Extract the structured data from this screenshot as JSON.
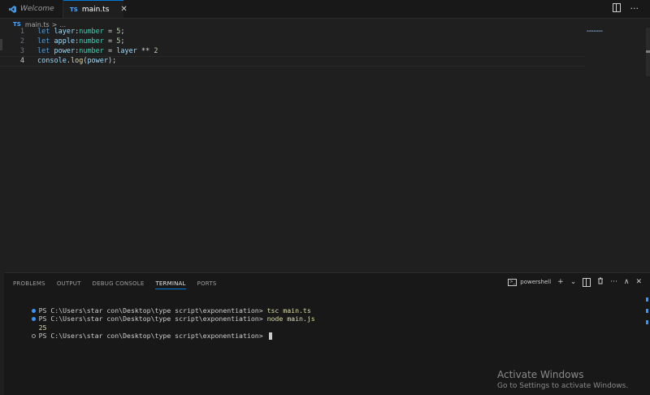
{
  "tabs": [
    {
      "label": "Welcome",
      "active": false
    },
    {
      "label": "main.ts",
      "active": true
    }
  ],
  "tab_badge": "TS",
  "breadcrumb": {
    "file": "main.ts",
    "separator": ">",
    "rest": "..."
  },
  "editor": {
    "lines": [
      {
        "number": "1",
        "tokens": [
          [
            "kw",
            "let"
          ],
          [
            "pl",
            " "
          ],
          [
            "var",
            "layer"
          ],
          [
            "pl",
            ":"
          ],
          [
            "ty",
            "number"
          ],
          [
            "pl",
            " = "
          ],
          [
            "num",
            "5"
          ],
          [
            "pl",
            ";"
          ]
        ]
      },
      {
        "number": "2",
        "tokens": [
          [
            "kw",
            "let"
          ],
          [
            "pl",
            " "
          ],
          [
            "var",
            "apple"
          ],
          [
            "pl",
            ":"
          ],
          [
            "ty",
            "number"
          ],
          [
            "pl",
            " = "
          ],
          [
            "num",
            "5"
          ],
          [
            "pl",
            ";"
          ]
        ]
      },
      {
        "number": "3",
        "tokens": [
          [
            "kw",
            "let"
          ],
          [
            "pl",
            " "
          ],
          [
            "var",
            "power"
          ],
          [
            "pl",
            ":"
          ],
          [
            "ty",
            "number"
          ],
          [
            "pl",
            " = "
          ],
          [
            "var",
            "layer"
          ],
          [
            "pl",
            " ** "
          ],
          [
            "num",
            "2"
          ]
        ]
      },
      {
        "number": "4",
        "tokens": [
          [
            "var",
            "console"
          ],
          [
            "pl",
            "."
          ],
          [
            "fn",
            "log"
          ],
          [
            "pl",
            "("
          ],
          [
            "var",
            "power"
          ],
          [
            "pl",
            ");"
          ]
        ]
      }
    ],
    "active_line": 4
  },
  "panel": {
    "tabs": [
      "PROBLEMS",
      "OUTPUT",
      "DEBUG CONSOLE",
      "TERMINAL",
      "PORTS"
    ],
    "active_tab": "TERMINAL",
    "shell": "powershell",
    "actions": {
      "add": "+",
      "dropdown": "⌄",
      "more": "···",
      "maximize": "∧",
      "close": "✕"
    }
  },
  "terminal": {
    "lines": [
      {
        "marker": "blue",
        "prompt": "PS C:\\Users\\star con\\Desktop\\type script\\exponentiation> ",
        "command": "tsc main.ts"
      },
      {
        "marker": "blue",
        "prompt": "PS C:\\Users\\star con\\Desktop\\type script\\exponentiation> ",
        "command": "node main.js"
      },
      {
        "marker": "none",
        "prompt": "",
        "command": "",
        "output": "25"
      },
      {
        "marker": "hollow",
        "prompt": "PS C:\\Users\\star con\\Desktop\\type script\\exponentiation> ",
        "command": "",
        "cursor": true
      }
    ]
  },
  "watermark": {
    "title": "Activate Windows",
    "subtitle": "Go to Settings to activate Windows."
  },
  "colors": {
    "accent": "#0078d4",
    "keyword": "#569cd6",
    "variable": "#9cdcfe",
    "type": "#4ec9b0",
    "number": "#b5cea8",
    "function": "#dcdcaa"
  }
}
